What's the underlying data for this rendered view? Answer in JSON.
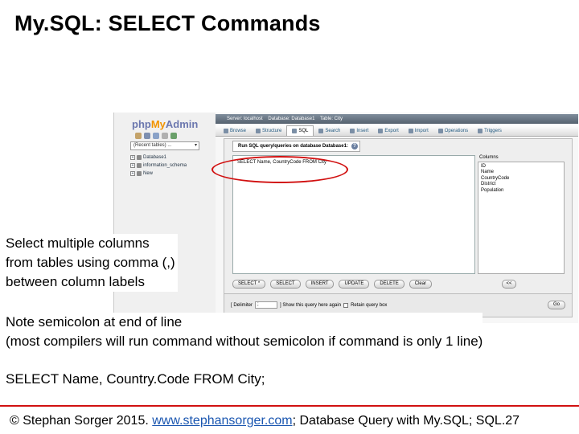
{
  "slide": {
    "title": "My.SQL: SELECT Commands",
    "notes": [
      [
        "Select multiple columns",
        "from tables using comma (,)",
        "between column labels"
      ],
      [
        "Note semicolon at end of line",
        "(most compilers will run command without semicolon if command is only 1 line)"
      ],
      [
        "SELECT Name, Country.Code FROM City;"
      ]
    ],
    "footer": {
      "prefix": "© Stephan Sorger 2015. ",
      "link": "www.stephansorger.com",
      "suffix": "; Database Query with My.SQL;  SQL.27"
    },
    "accent_color": "#d11010"
  },
  "phpmyadmin": {
    "logo": {
      "php": "php",
      "my": "My",
      "admin": "Admin"
    },
    "sidebar": {
      "recent_select": "(Recent tables) ...",
      "tree": [
        "Database1",
        "information_schema",
        "New"
      ]
    },
    "breadcrumb": [
      "Server: localhost",
      "Database: Database1",
      "Table: City"
    ],
    "tabs": [
      "Browse",
      "Structure",
      "SQL",
      "Search",
      "Insert",
      "Export",
      "Import",
      "Operations",
      "Triggers"
    ],
    "active_tab": "SQL",
    "sql_panel": {
      "legend": "Run SQL query/queries on database Database1:",
      "query": "SELECT Name, CountryCode FROM City",
      "columns_label": "Columns",
      "columns": [
        "ID",
        "Name",
        "CountryCode",
        "District",
        "Population"
      ],
      "buttons": [
        "SELECT *",
        "SELECT",
        "INSERT",
        "UPDATE",
        "DELETE",
        "Clear"
      ],
      "insert_button": "<<",
      "delimiter_label": "[ Delimiter",
      "delimiter_value": ";",
      "show_again_label": "] Show this query here again",
      "retain_label": "Retain query box",
      "go_button": "Go"
    }
  }
}
